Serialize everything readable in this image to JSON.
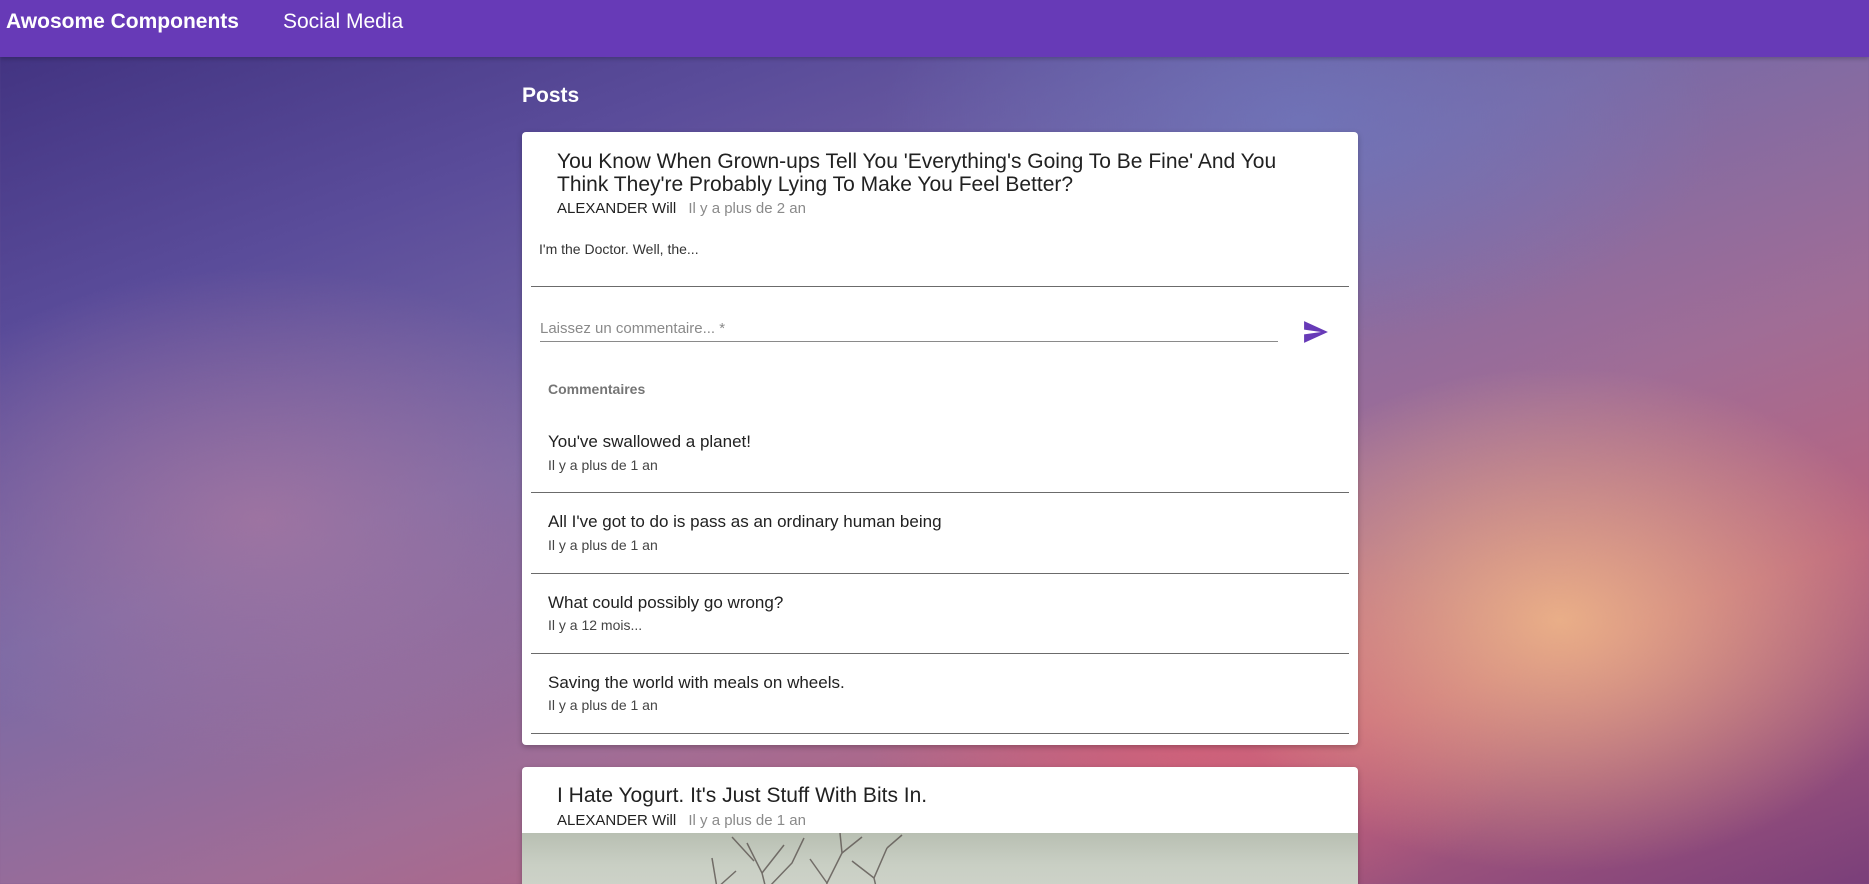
{
  "navbar": {
    "brand": "Awosome Components",
    "links": [
      "Social Media"
    ]
  },
  "page": {
    "section_title": "Posts"
  },
  "posts": [
    {
      "title": "You Know When Grown-ups Tell You 'Everything's Going To Be Fine' And You Think They're Probably Lying To Make You Feel Better?",
      "author": "ALEXANDER Will",
      "time": "Il y a plus de 2 an",
      "excerpt": "I'm the Doctor. Well, the...",
      "comment_placeholder": "Laissez un commentaire... *",
      "send_icon": "send-icon",
      "comments_header": "Commentaires",
      "comments": [
        {
          "text": "You've swallowed a planet!",
          "time": "Il y a plus de 1 an"
        },
        {
          "text": "All I've got to do is pass as an ordinary human being",
          "time": "Il y a plus de 1 an"
        },
        {
          "text": "What could possibly go wrong?",
          "time": "Il y a 12 mois..."
        },
        {
          "text": "Saving the world with meals on wheels.",
          "time": "Il y a plus de 1 an"
        }
      ]
    },
    {
      "title": "I Hate Yogurt. It's Just Stuff With Bits In.",
      "author": "ALEXANDER Will",
      "time": "Il y a plus de 1 an"
    }
  ],
  "colors": {
    "primary": "#673ab7",
    "card_background": "#ffffff",
    "text_primary": "#212121",
    "text_secondary": "#8a8a8a"
  }
}
